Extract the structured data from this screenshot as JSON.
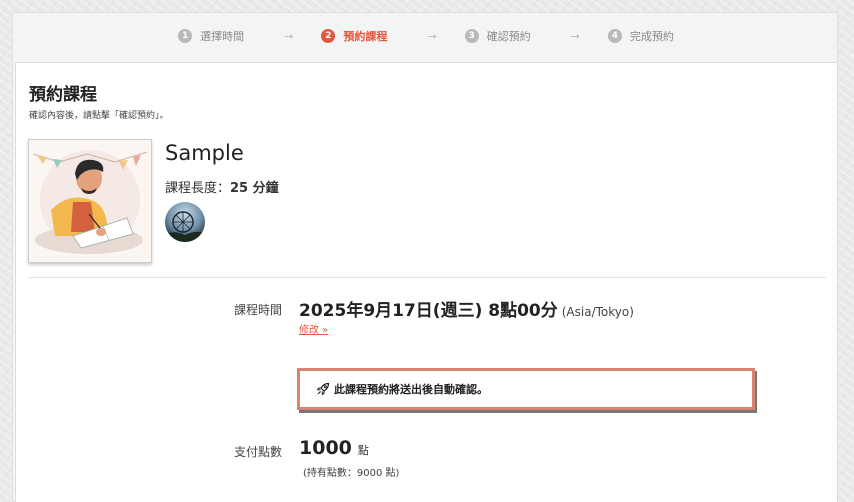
{
  "steps": [
    {
      "num": "1",
      "label": "選擇時間",
      "active": false
    },
    {
      "num": "2",
      "label": "預約課程",
      "active": true
    },
    {
      "num": "3",
      "label": "確認預約",
      "active": false
    },
    {
      "num": "4",
      "label": "完成預約",
      "active": false
    }
  ],
  "arrow": "→",
  "page": {
    "title": "預約課程",
    "subtitle": "確認內容後，請點擊「確認預約」。"
  },
  "course": {
    "name": "Sample",
    "length_label": "課程長度：",
    "length_value": "25 分鐘"
  },
  "schedule": {
    "label": "課程時間",
    "datetime": "2025年9月17日(週三) 8點00分",
    "timezone": "(Asia/Tokyo)",
    "edit_link": "修改 »"
  },
  "notice": {
    "text": "此課程預約將送出後自動確認。",
    "icon": "rocket-icon"
  },
  "payment": {
    "label": "支付點數",
    "points": "1000",
    "unit": "點",
    "held": "(持有點數：9000 點)"
  },
  "colors": {
    "accent": "#e3583e",
    "notice_border": "#d98470"
  }
}
